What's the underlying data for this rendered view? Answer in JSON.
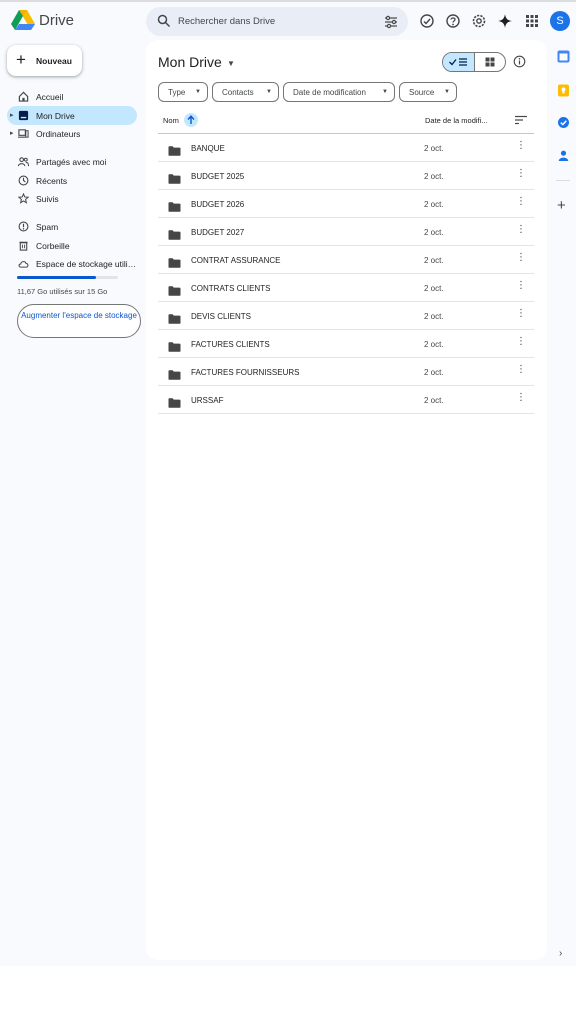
{
  "app": {
    "name": "Drive",
    "avatar_letter": "S"
  },
  "search": {
    "placeholder": "Rechercher dans Drive"
  },
  "header_icons": [
    "offline-status-icon",
    "help-icon",
    "settings-icon",
    "gemini-icon",
    "apps-grid-icon"
  ],
  "sidebar": {
    "new_label": "Nouveau",
    "items": [
      {
        "label": "Accueil",
        "icon": "home-icon"
      },
      {
        "label": "Mon Drive",
        "icon": "my-drive-icon",
        "active": true
      },
      {
        "label": "Ordinateurs",
        "icon": "computers-icon"
      },
      {
        "label": "Partagés avec moi",
        "icon": "shared-icon"
      },
      {
        "label": "Récents",
        "icon": "clock-icon"
      },
      {
        "label": "Suivis",
        "icon": "star-icon"
      },
      {
        "label": "Spam",
        "icon": "spam-icon"
      },
      {
        "label": "Corbeille",
        "icon": "trash-icon"
      },
      {
        "label": "Espace de stockage utili…",
        "icon": "cloud-icon"
      }
    ],
    "storage_text": "11,67 Go utilisés sur 15 Go",
    "storage_fraction": 0.78,
    "upgrade_label": "Augmenter l'espace de stockage"
  },
  "main": {
    "title": "Mon Drive",
    "filters": [
      "Type",
      "Contacts",
      "Date de modification",
      "Source"
    ],
    "columns": {
      "name": "Nom",
      "date": "Date de la modifi..."
    },
    "rows": [
      {
        "name": "BANQUE",
        "date": "2 oct."
      },
      {
        "name": "BUDGET 2025",
        "date": "2 oct."
      },
      {
        "name": "BUDGET 2026",
        "date": "2 oct."
      },
      {
        "name": "BUDGET 2027",
        "date": "2 oct."
      },
      {
        "name": "CONTRAT ASSURANCE",
        "date": "2 oct."
      },
      {
        "name": "CONTRATS CLIENTS",
        "date": "2 oct."
      },
      {
        "name": "DEVIS CLIENTS",
        "date": "2 oct."
      },
      {
        "name": "FACTURES CLIENTS",
        "date": "2 oct."
      },
      {
        "name": "FACTURES FOURNISSEURS",
        "date": "2 oct."
      },
      {
        "name": "URSSAF",
        "date": "2 oct."
      }
    ]
  },
  "colors": {
    "accent": "#0b57d0",
    "active_bg": "#c2e7ff",
    "app_bg": "#f8fafd"
  }
}
